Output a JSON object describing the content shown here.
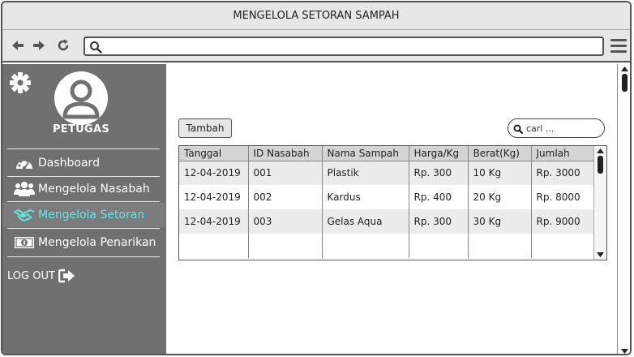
{
  "window": {
    "title": "MENGELOLA SETORAN SAMPAH"
  },
  "browser": {
    "icons": [
      "arrow-left-icon",
      "arrow-right-icon",
      "reload-icon",
      "search-icon",
      "hamburger-menu-icon"
    ],
    "url_value": ""
  },
  "sidebar": {
    "role_label": "PETUGAS",
    "items": [
      {
        "label": "Dashboard",
        "icon": "dashboard-gauge-icon",
        "active": false
      },
      {
        "label": "Mengelola Nasabah",
        "icon": "users-icon",
        "active": false
      },
      {
        "label": "Mengelola Setoran",
        "icon": "handshake-icon",
        "active": true
      },
      {
        "label": "Mengelola Penarikan",
        "icon": "money-icon",
        "active": false
      }
    ],
    "logout_label": "LOG OUT",
    "active_color": "#5fe3e3",
    "background_color": "#707070"
  },
  "content": {
    "add_button_label": "Tambah",
    "search_placeholder": "cari ...",
    "table": {
      "columns": [
        "Tanggal",
        "ID Nasabah",
        "Nama Sampah",
        "Harga/Kg",
        "Berat(Kg)",
        "Jumlah"
      ],
      "rows": [
        [
          "12-04-2019",
          "001",
          "Plastik",
          "Rp. 300",
          "10 Kg",
          "Rp. 3000"
        ],
        [
          "12-04-2019",
          "002",
          "Kardus",
          "Rp. 400",
          "20 Kg",
          "Rp. 8000"
        ],
        [
          "12-04-2019",
          "003",
          "Gelas Aqua",
          "Rp. 300",
          "30 Kg",
          "Rp. 9000"
        ],
        [
          "",
          "",
          "",
          "",
          "",
          ""
        ]
      ]
    }
  }
}
